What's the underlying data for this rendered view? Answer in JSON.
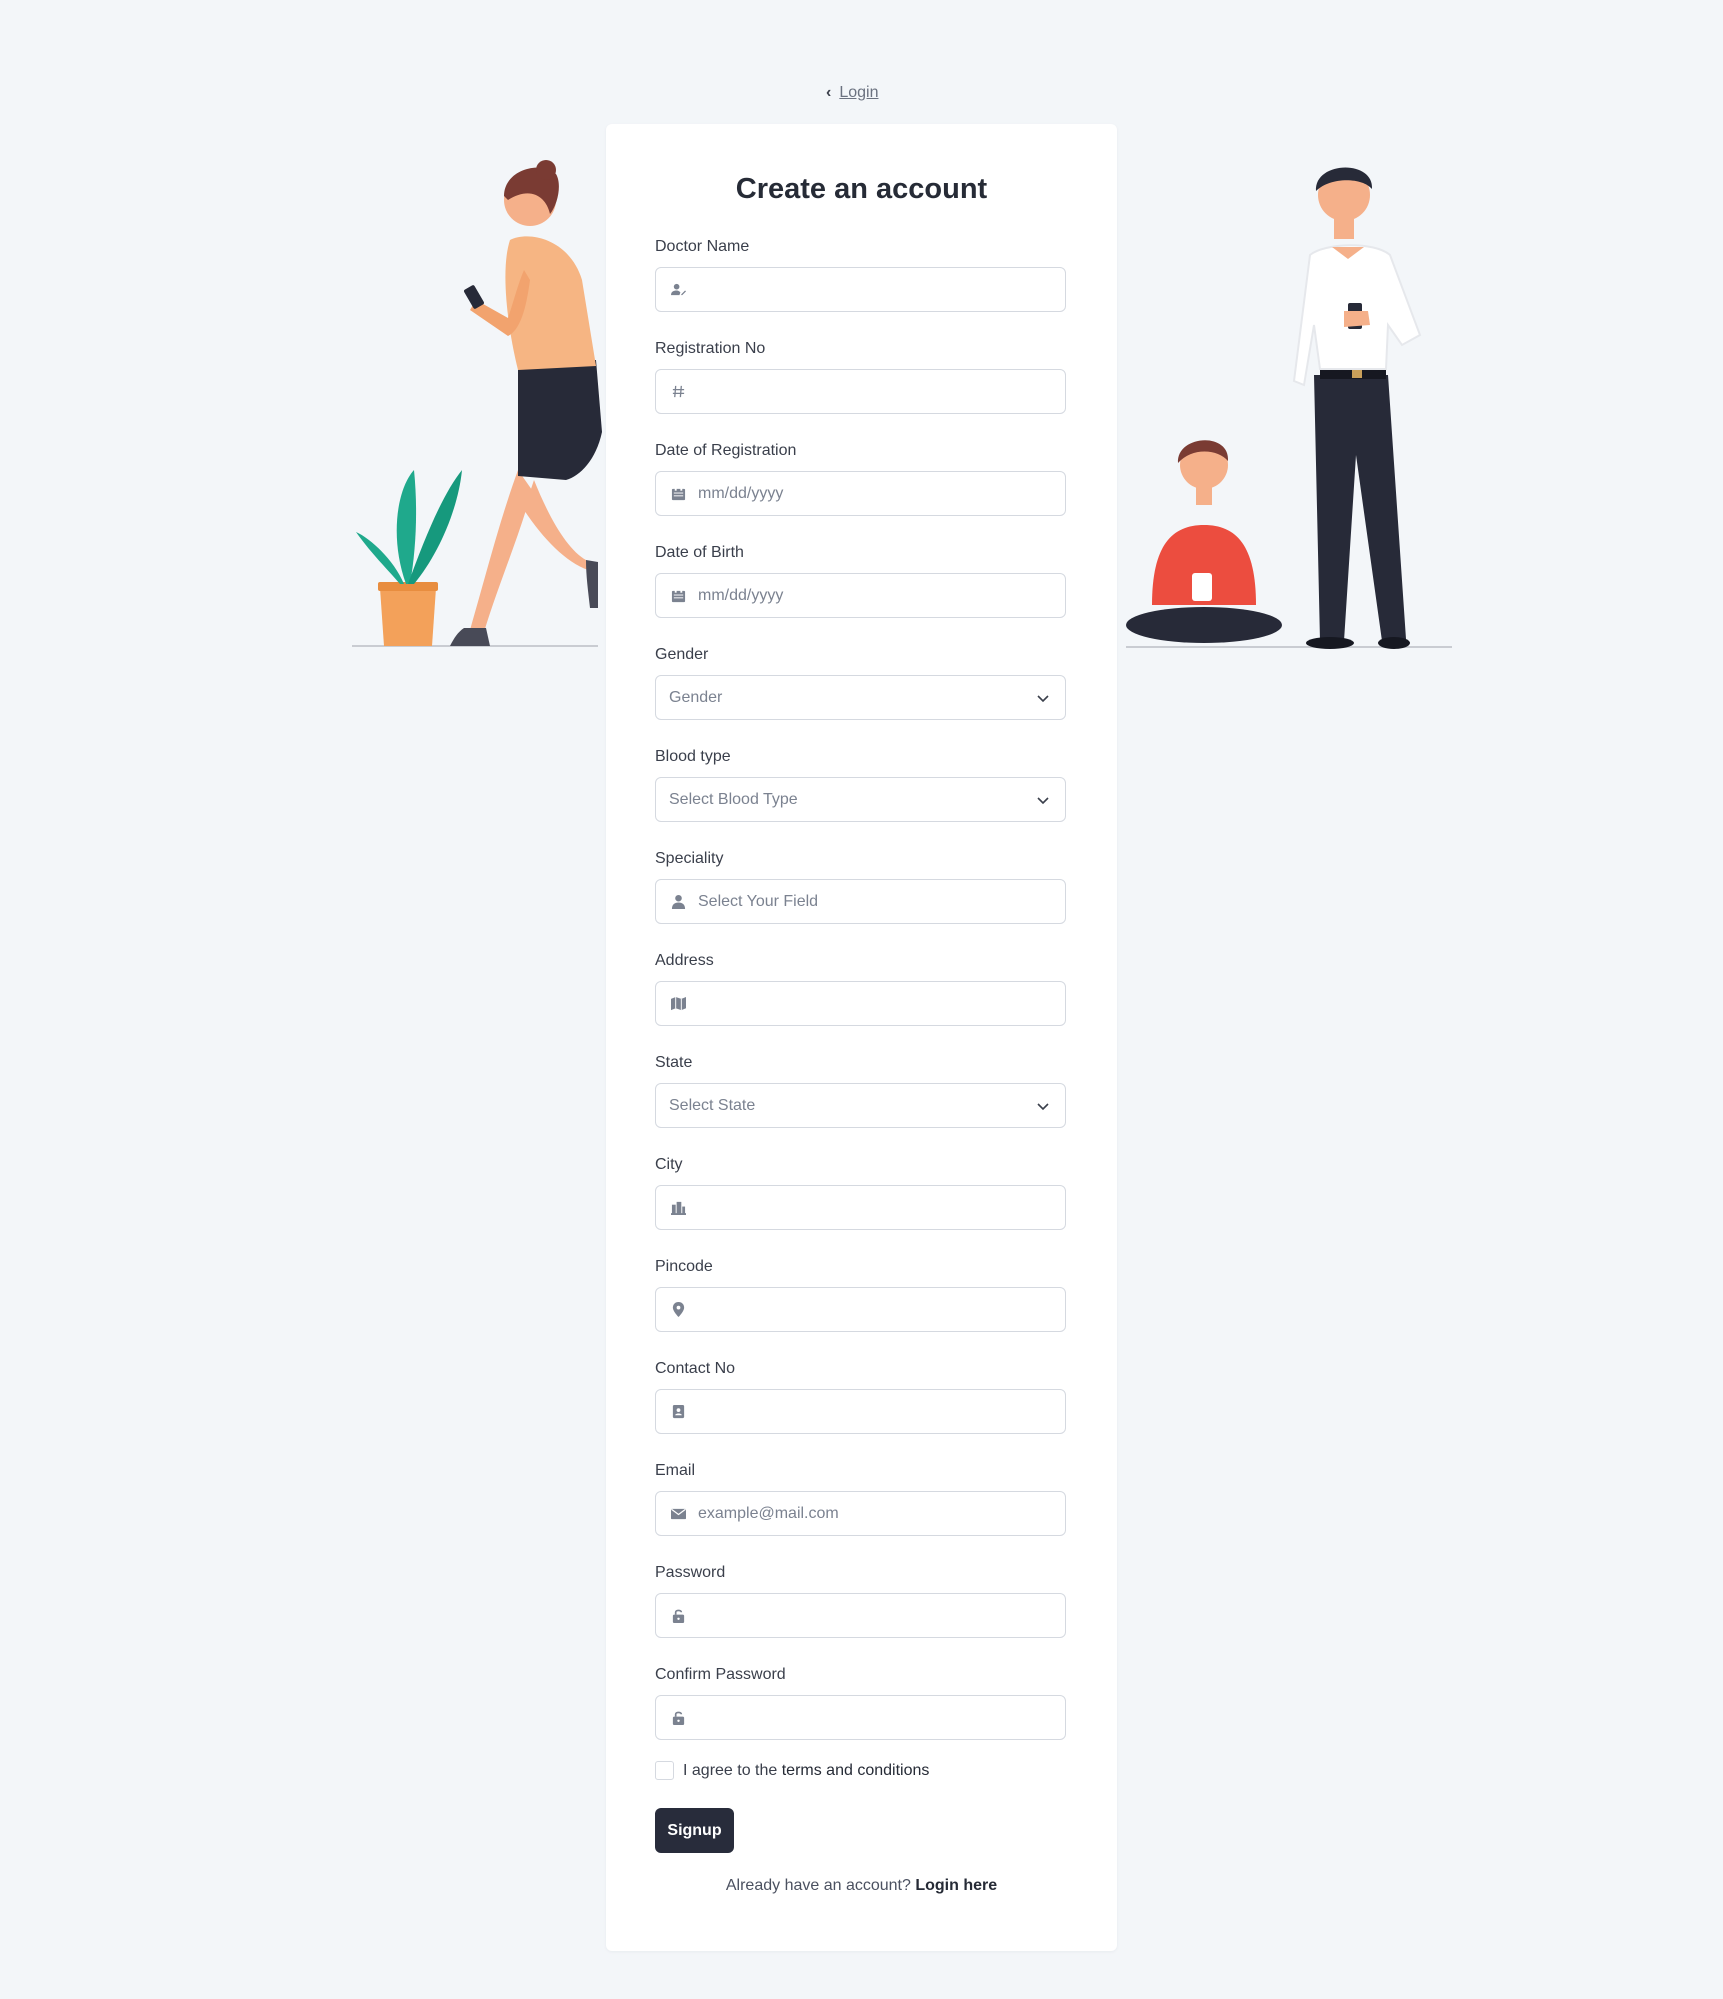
{
  "nav": {
    "back_label": "Login"
  },
  "form": {
    "title": "Create an account",
    "fields": [
      {
        "label": "Doctor Name",
        "placeholder": ""
      },
      {
        "label": "Registration No",
        "placeholder": ""
      },
      {
        "label": "Date of Registration",
        "placeholder": "mm/dd/yyyy"
      },
      {
        "label": "Date of Birth",
        "placeholder": "mm/dd/yyyy"
      },
      {
        "label": "Gender",
        "placeholder": "Gender"
      },
      {
        "label": "Blood type",
        "placeholder": "Select Blood Type"
      },
      {
        "label": "Speciality",
        "placeholder": "Select Your Field"
      },
      {
        "label": "Address",
        "placeholder": ""
      },
      {
        "label": "State",
        "placeholder": "Select State"
      },
      {
        "label": "City",
        "placeholder": ""
      },
      {
        "label": "Pincode",
        "placeholder": ""
      },
      {
        "label": "Contact No",
        "placeholder": ""
      },
      {
        "label": "Email",
        "placeholder": "example@mail.com"
      },
      {
        "label": "Password",
        "placeholder": ""
      },
      {
        "label": "Confirm Password",
        "placeholder": ""
      }
    ],
    "terms": {
      "prefix": "I agree to the ",
      "link": "terms and conditions"
    },
    "submit_label": "Signup",
    "footer": {
      "text": "Already have an account? ",
      "link": "Login here"
    }
  },
  "colors": {
    "background": "#f3f6f9",
    "card": "#ffffff",
    "button": "#282c3b",
    "border": "#d5d9e0"
  }
}
